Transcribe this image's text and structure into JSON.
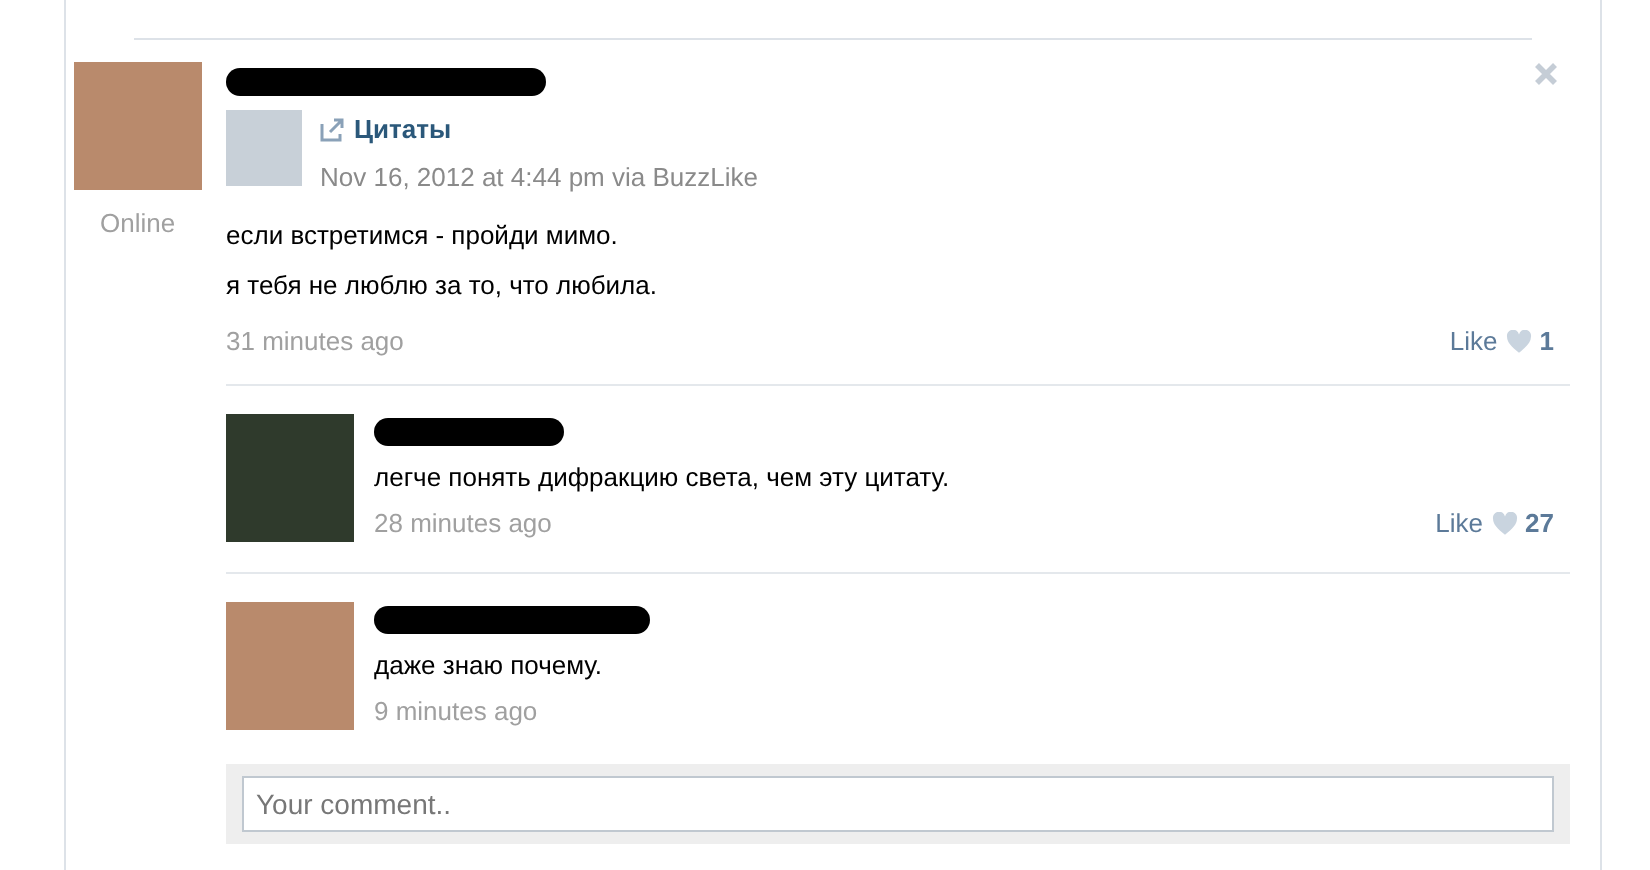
{
  "post": {
    "status": "Online",
    "repost": {
      "source": "Цитаты",
      "meta": "Nov 16, 2012 at 4:44 pm via BuzzLike"
    },
    "lines": [
      "если встретимся - пройди мимо.",
      "я тебя не люблю за то, что любила."
    ],
    "time": "31 minutes ago",
    "like_label": "Like",
    "like_count": "1"
  },
  "comments": [
    {
      "text": "легче понять дифракцию света, чем эту цитату.",
      "time": "28 minutes ago",
      "like_label": "Like",
      "like_count": "27",
      "kind": "dark"
    },
    {
      "text": "даже знаю почему.",
      "time": "9 minutes ago",
      "kind": "photo"
    }
  ],
  "comment_field": {
    "placeholder": "Your comment.."
  }
}
